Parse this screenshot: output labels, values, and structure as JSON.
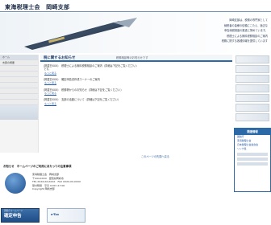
{
  "header": {
    "title": "東海税理士会　岡崎支部"
  },
  "hero": {
    "lines": [
      "岡崎支部は、税務の専門家として",
      "納税者の皆様の信頼にこたえ、適正な",
      "申告納税制度の推進に努めています。",
      "税理士による無料税務相談のご案内",
      "税務に関する各種情報を提供しています"
    ]
  },
  "left_nav": {
    "items": [
      "ホーム",
      "支部の概要",
      "",
      "",
      "",
      "",
      "",
      "",
      "",
      "",
      ""
    ]
  },
  "news": {
    "title": "税に関するお知らせ",
    "subtitle": "税務相談等のお知らせです",
    "items": [
      {
        "body": "（掲載日XXX）　税理士による無料税務相談のご案内（詳細は下記をご覧ください）",
        "cont": "です。",
        "more": "もっと見る"
      },
      {
        "body": "（掲載日XXX）　確定申告書作成コーナーのご案内",
        "cont": "",
        "more": "もっと見る"
      },
      {
        "body": "（掲載日XXX）　税務署からのお知らせ（詳細は下記をご覧ください）",
        "cont": "",
        "more": "もっと見る"
      },
      {
        "body": "（掲載日XXX）　支部の活動について（詳細は下記をご覧ください）",
        "cont": "",
        "more": "もっと見る"
      }
    ]
  },
  "footer_link": "このページの先頭へ戻る",
  "notice": "お知らせ　ホームページのご利用にあたっての注意事項",
  "contact": {
    "lines": [
      "東海税理士会　岡崎支部",
      "〒444-XXXX　愛知県岡崎市",
      "TEL XXXX-XX-XXXX　FAX XXXX-XX-XXXX",
      "受付時間　平日 9:00～17:00",
      "Copyright 岡崎支部"
    ]
  },
  "sidebar": {
    "head": "関連情報",
    "links": [
      "国税庁",
      "東海税理士会",
      "日本税理士会連合会",
      "リンク集"
    ]
  },
  "banners": {
    "left_top": "国税庁ホームページ",
    "left_main": "確定申告",
    "mid": "e-Tax"
  },
  "colors": {
    "accent": "#2b6aa6",
    "title": "#1a2a44",
    "link": "#2257a0"
  }
}
